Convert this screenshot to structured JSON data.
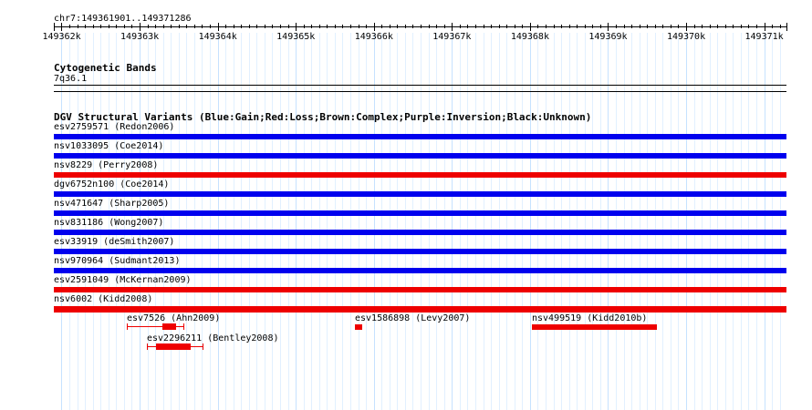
{
  "ruler": {
    "location": "chr7:149361901..149371286",
    "start": 149361901,
    "end": 149371286,
    "ticks": [
      {
        "value": 149362000,
        "label": "149362k"
      },
      {
        "value": 149363000,
        "label": "149363k"
      },
      {
        "value": 149364000,
        "label": "149364k"
      },
      {
        "value": 149365000,
        "label": "149365k"
      },
      {
        "value": 149366000,
        "label": "149366k"
      },
      {
        "value": 149367000,
        "label": "149367k"
      },
      {
        "value": 149368000,
        "label": "149368k"
      },
      {
        "value": 149369000,
        "label": "149369k"
      },
      {
        "value": 149370000,
        "label": "149370k"
      },
      {
        "value": 149371000,
        "label": "149371k"
      }
    ]
  },
  "cytoband": {
    "title": "Cytogenetic Bands",
    "band": "7q36.1"
  },
  "dgv": {
    "title": "DGV Structural Variants (Blue:Gain;Red:Loss;Brown:Complex;Purple:Inversion;Black:Unknown)",
    "colors": {
      "gain": "#0000ee",
      "loss": "#ee0000"
    },
    "full_tracks": [
      {
        "label": "esv2759571 (Redon2006)",
        "type": "gain"
      },
      {
        "label": "nsv1033095 (Coe2014)",
        "type": "gain"
      },
      {
        "label": "nsv8229 (Perry2008)",
        "type": "loss"
      },
      {
        "label": "dgv6752n100 (Coe2014)",
        "type": "gain"
      },
      {
        "label": "nsv471647 (Sharp2005)",
        "type": "gain"
      },
      {
        "label": "nsv831186 (Wong2007)",
        "type": "gain"
      },
      {
        "label": "esv33919 (deSmith2007)",
        "type": "gain"
      },
      {
        "label": "nsv970964 (Sudmant2013)",
        "type": "gain"
      },
      {
        "label": "esv2591049 (McKernan2009)",
        "type": "loss"
      },
      {
        "label": "nsv6002 (Kidd2008)",
        "type": "loss"
      }
    ],
    "features": [
      {
        "label": "esv7526 (Ahn2009)"
      },
      {
        "label": "esv1586898 (Levy2007)"
      },
      {
        "label": "nsv499519 (Kidd2010b)"
      },
      {
        "label": "esv2296211 (Bentley2008)"
      }
    ]
  }
}
